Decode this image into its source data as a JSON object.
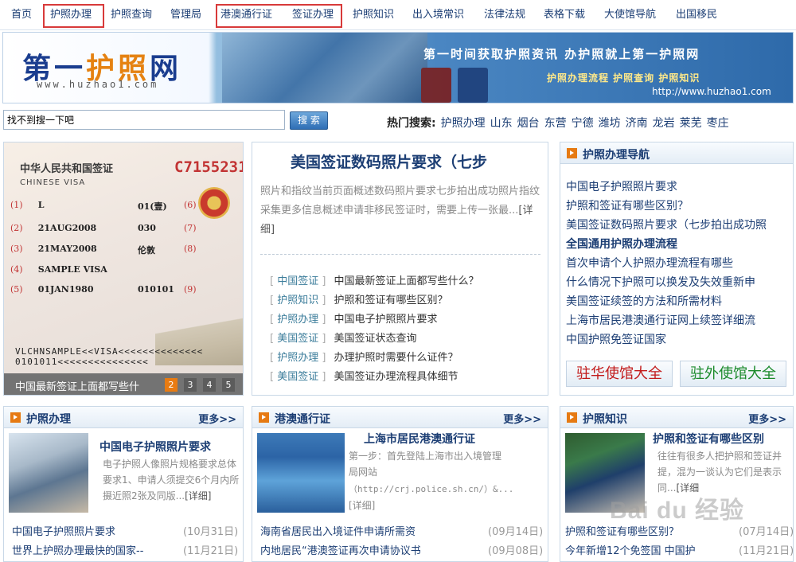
{
  "nav": {
    "items": [
      "首页",
      "护照办理",
      "护照查询",
      "管理局",
      "港澳通行证",
      "签证办理",
      "护照知识",
      "出入境常识",
      "法律法规",
      "表格下载",
      "大使馆导航",
      "出国移民"
    ]
  },
  "banner": {
    "logo_part1": "第一",
    "logo_part2": "护照",
    "logo_part3": "网",
    "logo_url": "www.huzhao1.com",
    "slogan": "第一时间获取护照资讯 办护照就上第一护照网",
    "slogan2": "护照办理流程 护照查询 护照知识",
    "url": "http://www.huzhao1.com"
  },
  "search": {
    "value": "找不到搜一下吧",
    "button": "搜 索",
    "hot_label": "热门搜索:",
    "hot_keywords": [
      "护照办理",
      "山东",
      "烟台",
      "东营",
      "宁德",
      "潍坊",
      "济南",
      "龙岩",
      "莱芜",
      "枣庄"
    ]
  },
  "slide": {
    "visa_header": "中华人民共和国签证",
    "visa_en": "CHINESE VISA",
    "visa_no": "C7155231",
    "rows": [
      {
        "n": "(1)",
        "v": "L",
        "m": "01(壹)",
        "r": "(6)"
      },
      {
        "n": "(2)",
        "v": "21AUG2008",
        "m": "030",
        "r": "(7)"
      },
      {
        "n": "(3)",
        "v": "21MAY2008",
        "m": "伦敦",
        "r": "(8)"
      },
      {
        "n": "(4)",
        "v": "SAMPLE VISA",
        "m": "",
        "r": ""
      },
      {
        "n": "(5)",
        "v": "01JAN1980",
        "m": "010101",
        "r": "(9)"
      }
    ],
    "mrz1": "VLCHNSAMPLE<<VISA<<<<<<<<<<<<<<",
    "mrz2": "0101011<<<<<<<<<<<<<<<",
    "caption": "中国最新签证上面都写些什",
    "pages": [
      "2",
      "3",
      "4",
      "5"
    ],
    "active_page": "2"
  },
  "feature": {
    "title": "美国签证数码照片要求（七步",
    "desc": "照片和指纹当前页面概述数码照片要求七步拍出成功照片指纹采集更多信息概述申请非移民签证时，需要上传一张最...",
    "more": "[详细]",
    "list": [
      {
        "cat": "中国签证",
        "title": "中国最新签证上面都写些什么？"
      },
      {
        "cat": "护照知识",
        "title": "护照和签证有哪些区别？"
      },
      {
        "cat": "护照办理",
        "title": "中国电子护照照片要求"
      },
      {
        "cat": "美国签证",
        "title": "美国签证状态查询"
      },
      {
        "cat": "护照办理",
        "title": "办理护照时需要什么证件？"
      },
      {
        "cat": "美国签证",
        "title": "美国签证办理流程具体细节"
      }
    ]
  },
  "guide": {
    "title": "护照办理导航",
    "items": [
      "中国电子护照照片要求",
      "护照和签证有哪些区别？",
      "美国签证数码照片要求（七步拍出成功照",
      "全国通用护照办理流程",
      "首次申请个人护照办理流程有哪些",
      "什么情况下护照可以换发及失效重新申",
      "美国签证续签的方法和所需材料",
      "上海市居民港澳通行证网上续签详细流",
      "中国护照免签证国家"
    ],
    "embassy_cn": "驻华使馆大全",
    "embassy_abroad": "驻外使馆大全"
  },
  "panels": [
    {
      "title": "护照办理",
      "more": "更多>>",
      "feature_title": "中国电子护照照片要求",
      "desc": "电子护照人像照片规格要求总体要求1、申请人须提交6个月内所摄近照2张及同版...",
      "detail": "[详细]",
      "list": [
        {
          "t": "中国电子护照照片要求",
          "d": "(10月31日)"
        },
        {
          "t": "世界上护照办理最快的国家--",
          "d": "(11月21日)"
        }
      ]
    },
    {
      "title": "港澳通行证",
      "more": "更多>>",
      "feature_title": "上海市居民港澳通行证",
      "desc": "第一步：首先登陆上海市出入境管理局网站",
      "desc2": "（http://crj.police.sh.cn/）&...",
      "detail": "[详细]",
      "list": [
        {
          "t": "海南省居民出入境证件申请所需资",
          "d": "(09月14日)"
        },
        {
          "t": "内地居民“港澳签证再次申请协议书",
          "d": "(09月08日)"
        }
      ]
    },
    {
      "title": "护照知识",
      "more": "更多>>",
      "feature_title": "护照和签证有哪些区别",
      "desc": "往往有很多人把护照和签证并提，混为一谈认为它们是表示同...",
      "detail": "[详细",
      "list": [
        {
          "t": "护照和签证有哪些区别？",
          "d": "(07月14日)"
        },
        {
          "t": "今年新增12个免签国 中国护",
          "d": "(11月21日)"
        }
      ]
    }
  ],
  "watermark": "Bai du 经验",
  "colors": {
    "nav_text": "#1c3e74",
    "highlight_box": "#d83a3a",
    "accent_orange": "#e67a12",
    "link_blue": "#1c3e74"
  }
}
